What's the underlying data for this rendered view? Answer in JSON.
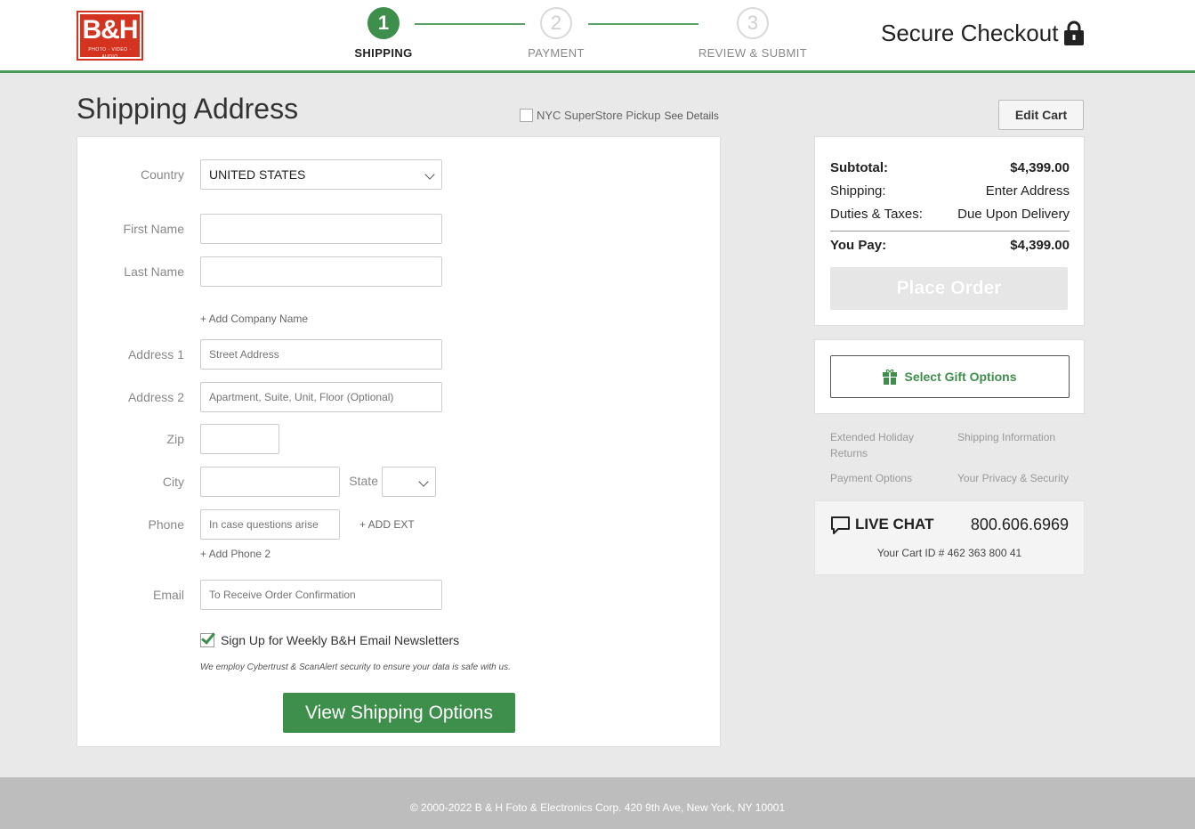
{
  "header": {
    "logo_mark": "B&H",
    "logo_sub": "PHOTO · VIDEO · AUDIO",
    "steps": [
      {
        "number": "1",
        "label": "SHIPPING"
      },
      {
        "number": "2",
        "label": "PAYMENT"
      },
      {
        "number": "3",
        "label": "REVIEW & SUBMIT"
      }
    ],
    "secure_checkout": "Secure Checkout"
  },
  "title_row": {
    "title": "Shipping Address",
    "pickup_label": "NYC SuperStore Pickup",
    "see_details": "See Details",
    "edit_cart": "Edit Cart"
  },
  "form": {
    "country_label": "Country",
    "country_value": "UNITED STATES",
    "first_name_label": "First Name",
    "last_name_label": "Last Name",
    "add_company": "+ Add Company Name",
    "address1_label": "Address 1",
    "address1_placeholder": "Street Address",
    "address2_label": "Address 2",
    "address2_placeholder": "Apartment, Suite, Unit, Floor (Optional)",
    "zip_label": "Zip",
    "city_label": "City",
    "state_label": "State",
    "phone_label": "Phone",
    "phone_placeholder": "In case questions arise",
    "add_ext": "+ ADD EXT",
    "add_phone2": "+ Add Phone 2",
    "email_label": "Email",
    "email_placeholder": "To Receive Order Confirmation",
    "newsletter_label": "Sign Up for Weekly B&H Email Newsletters",
    "newsletter_checked": true,
    "security_note": "We employ Cybertrust & ScanAlert security to ensure your data is safe with us.",
    "submit_label": "View Shipping Options"
  },
  "summary": {
    "subtotal_label": "Subtotal:",
    "subtotal_value": "$4,399.00",
    "shipping_label": "Shipping:",
    "shipping_value": "Enter Address",
    "duties_label": "Duties & Taxes:",
    "duties_value": "Due Upon Delivery",
    "you_pay_label": "You Pay:",
    "you_pay_value": "$4,399.00",
    "place_order": "Place Order"
  },
  "gift": {
    "label": "Select Gift Options"
  },
  "info_links": {
    "extended": "Extended Holiday Returns",
    "shipping_info": "Shipping Information",
    "payment_options": "Payment Options",
    "privacy": "Your Privacy & Security"
  },
  "chat": {
    "live_chat": "LIVE CHAT",
    "phone": "800.606.6969",
    "cart_id": "Your Cart ID # 462 363 800 41"
  },
  "footer": {
    "copyright": "© 2000-2022 B & H Foto & Electronics Corp. 420 9th Ave, New York, NY 10001"
  },
  "colors": {
    "accent_green": "#3f8f4c",
    "brand_red": "#d3331f"
  }
}
